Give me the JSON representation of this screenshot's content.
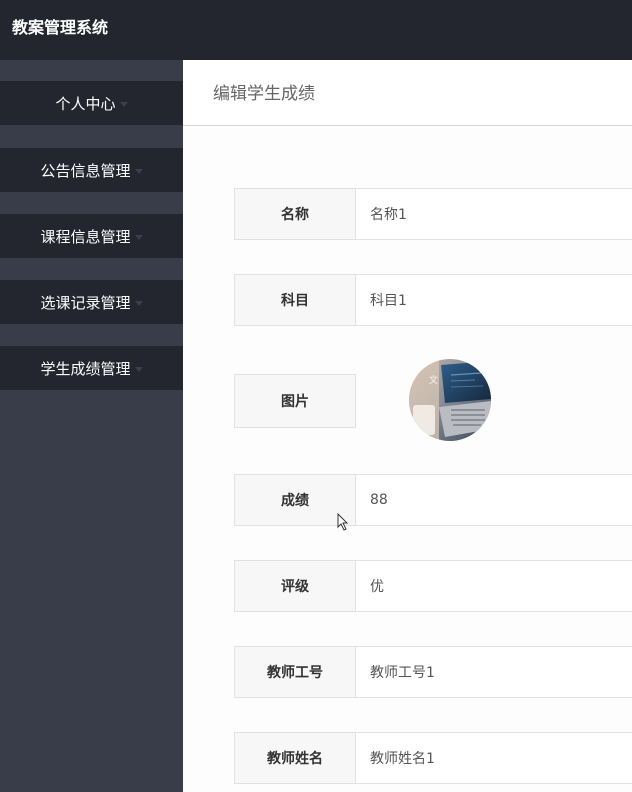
{
  "app": {
    "title": "教案管理系统"
  },
  "sidebar": {
    "items": [
      {
        "label": "个人中心"
      },
      {
        "label": "公告信息管理"
      },
      {
        "label": "课程信息管理"
      },
      {
        "label": "选课记录管理"
      },
      {
        "label": "学生成绩管理"
      }
    ]
  },
  "page": {
    "title": "编辑学生成绩"
  },
  "form": {
    "name": {
      "label": "名称",
      "value": "名称1"
    },
    "subject": {
      "label": "科目",
      "value": "科目1"
    },
    "image": {
      "label": "图片"
    },
    "score": {
      "label": "成绩",
      "value": "88"
    },
    "grade": {
      "label": "评级",
      "value": "优"
    },
    "teacher_id": {
      "label": "教师工号",
      "value": "教师工号1"
    },
    "teacher_name": {
      "label": "教师姓名",
      "value": "教师姓名1"
    }
  },
  "colors": {
    "topbar": "#23262e",
    "sidebar": "#393d49",
    "menu_item": "#23262e"
  }
}
